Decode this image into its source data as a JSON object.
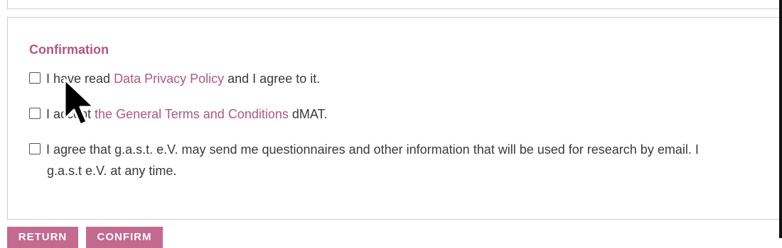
{
  "section": {
    "title": "Confirmation"
  },
  "checkboxes": [
    {
      "prefix": "I have read ",
      "link": "Data Privacy Policy",
      "suffix": " and I agree to it."
    },
    {
      "prefix": "I accept ",
      "link": "the General Terms and Conditions",
      "suffix": " dMAT."
    },
    {
      "line1": "I agree that g.a.s.t. e.V. may send me questionnaires and other information that will be used for research by email. I",
      "line2": "g.a.s.t e.V. at any time."
    }
  ],
  "buttons": {
    "return_label": "RETURN",
    "confirm_label": "CONFIRM"
  },
  "colors": {
    "accent": "#b5567f",
    "button": "#c46a90",
    "border": "#cfcfcf"
  }
}
